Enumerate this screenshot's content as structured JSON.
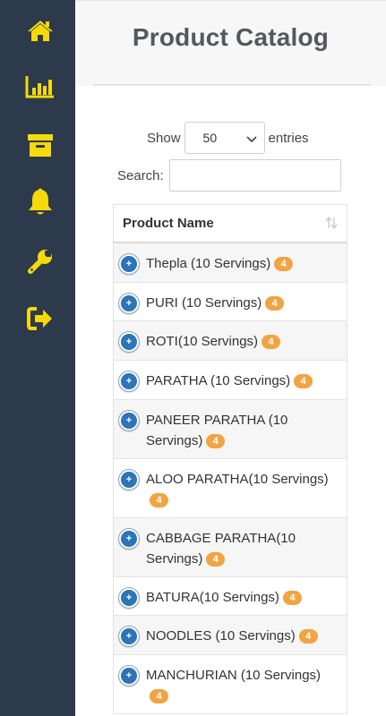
{
  "header": {
    "title": "Product Catalog"
  },
  "nav": [
    {
      "icon": "home-icon"
    },
    {
      "icon": "bar-chart-icon"
    },
    {
      "icon": "archive-icon"
    },
    {
      "icon": "bell-icon"
    },
    {
      "icon": "wrench-icon"
    },
    {
      "icon": "sign-out-icon"
    }
  ],
  "controls": {
    "show_label": "Show",
    "entries_label": "entries",
    "page_length": "50",
    "search_label": "Search:",
    "search_value": ""
  },
  "table": {
    "column_header": "Product Name",
    "rows": [
      {
        "name": "Thepla (10 Servings)",
        "badge": "4"
      },
      {
        "name": "PURI (10 Servings)",
        "badge": "4"
      },
      {
        "name": "ROTI(10 Servings)",
        "badge": "4"
      },
      {
        "name": "PARATHA (10 Servings)",
        "badge": "4"
      },
      {
        "name": "PANEER PARATHA (10 Servings)",
        "badge": "4"
      },
      {
        "name": "ALOO PARATHA(10 Servings)",
        "badge": "4"
      },
      {
        "name": "CABBAGE PARATHA(10 Servings)",
        "badge": "4"
      },
      {
        "name": "BATURA(10 Servings)",
        "badge": "4"
      },
      {
        "name": "NOODLES (10 Servings)",
        "badge": "4"
      },
      {
        "name": "MANCHURIAN (10 Servings)",
        "badge": "4"
      }
    ]
  },
  "colors": {
    "sidebar": "#2c3a4b",
    "icon": "#f5d90a",
    "expand_button": "#2d74b9",
    "badge": "#f0a542"
  }
}
